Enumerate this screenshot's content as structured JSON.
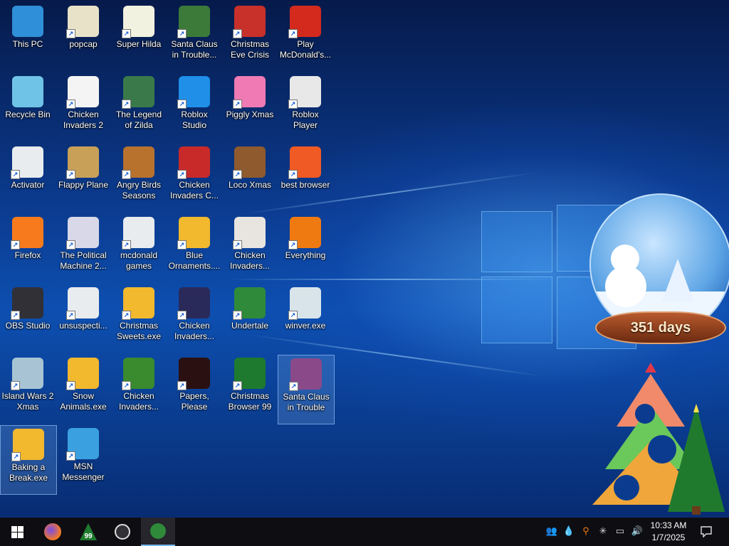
{
  "desktop": {
    "icons": [
      {
        "label": "This PC",
        "icon": "computer-icon",
        "color": "#2f8fd8"
      },
      {
        "label": "popcap",
        "icon": "folder-icon",
        "color": "#e8e2c8"
      },
      {
        "label": "Super Hilda",
        "icon": "game-icon",
        "color": "#f2f2e0"
      },
      {
        "label": "Santa Claus in Trouble... A...",
        "icon": "santa-icon",
        "color": "#3c7a3a"
      },
      {
        "label": "Christmas Eve Crisis",
        "icon": "santa-icon",
        "color": "#c8302a"
      },
      {
        "label": "Play McDonald's...",
        "icon": "mcdonalds-icon",
        "color": "#d42a1e"
      },
      {
        "label": "Recycle Bin",
        "icon": "recycle-bin-icon",
        "color": "#6fc3e6"
      },
      {
        "label": "Chicken Invaders 2",
        "icon": "chicken-icon",
        "color": "#f4f4f4"
      },
      {
        "label": "The Legend of Zilda",
        "icon": "game-icon",
        "color": "#3a7a4a"
      },
      {
        "label": "Roblox Studio",
        "icon": "roblox-studio-icon",
        "color": "#1f8fe8"
      },
      {
        "label": "Piggly Xmas",
        "icon": "pig-icon",
        "color": "#f07ab4"
      },
      {
        "label": "Roblox Player",
        "icon": "roblox-icon",
        "color": "#e8e8e8"
      },
      {
        "label": "Activator",
        "icon": "folder-icon",
        "color": "#e8ecee"
      },
      {
        "label": "Flappy Plane",
        "icon": "game-icon",
        "color": "#c8a058"
      },
      {
        "label": "Angry Birds Seasons",
        "icon": "angry-birds-icon",
        "color": "#b8722e"
      },
      {
        "label": "Chicken Invaders C...",
        "icon": "snowman-icon",
        "color": "#c82a2a"
      },
      {
        "label": "Loco Xmas",
        "icon": "bear-icon",
        "color": "#8e5a2e"
      },
      {
        "label": "best browser",
        "icon": "brave-icon",
        "color": "#f05a24"
      },
      {
        "label": "Firefox",
        "icon": "firefox-icon",
        "color": "#f77b1c"
      },
      {
        "label": "The Political Machine 2...",
        "icon": "political-icon",
        "color": "#d8d8e8"
      },
      {
        "label": "mcdonald games",
        "icon": "folder-icon",
        "color": "#e8ecee"
      },
      {
        "label": "Blue Ornaments....",
        "icon": "exe-icon",
        "color": "#f2b82e"
      },
      {
        "label": "Chicken Invaders...",
        "icon": "chicken-icon",
        "color": "#e8e4e0"
      },
      {
        "label": "Everything",
        "icon": "search-icon",
        "color": "#f07a12"
      },
      {
        "label": "OBS Studio",
        "icon": "obs-icon",
        "color": "#303036"
      },
      {
        "label": "unsuspecti...",
        "icon": "folder-icon",
        "color": "#e8ecee"
      },
      {
        "label": "Christmas Sweets.exe",
        "icon": "exe-icon",
        "color": "#f2b82e"
      },
      {
        "label": "Chicken Invaders...",
        "icon": "chicken-icon",
        "color": "#2a2a5a"
      },
      {
        "label": "Undertale",
        "icon": "undertale-icon",
        "color": "#2f8a3a"
      },
      {
        "label": "winver.exe",
        "icon": "window-icon",
        "color": "#d8e4ea"
      },
      {
        "label": "Island Wars 2 Xmas",
        "icon": "game-icon",
        "color": "#a8c4d4"
      },
      {
        "label": "Snow Animals.exe",
        "icon": "exe-icon",
        "color": "#f2b82e"
      },
      {
        "label": "Chicken Invaders...",
        "icon": "chicken-icon",
        "color": "#3a8a2e"
      },
      {
        "label": "Papers, Please",
        "icon": "papers-please-icon",
        "color": "#2a1010"
      },
      {
        "label": "Christmas Browser 99",
        "icon": "tree-icon",
        "color": "#1e7a2e"
      },
      {
        "label": "Santa Claus in Trouble",
        "icon": "santa-icon",
        "color": "#8a4a8a"
      },
      {
        "label": "Baking a Break.exe",
        "icon": "exe-icon",
        "color": "#f2b82e"
      },
      {
        "label": "MSN Messenger",
        "icon": "msn-icon",
        "color": "#3aa0e0"
      }
    ],
    "widget": {
      "days_text": "351 days"
    }
  },
  "taskbar": {
    "apps": [
      {
        "name": "start-icon"
      },
      {
        "name": "firefox-icon",
        "color": "#f77b1c"
      },
      {
        "name": "christmas-browser-icon",
        "color": "#1e7a2e",
        "text": "99"
      },
      {
        "name": "obs-icon",
        "color": "#303036"
      },
      {
        "name": "undertale-icon",
        "color": "#2f8a3a"
      }
    ],
    "tray_icons": [
      "people-icon",
      "droplet-icon",
      "search-icon",
      "snowflake-icon",
      "network-icon",
      "volume-icon"
    ],
    "time": "10:33 AM",
    "date": "1/7/2025",
    "notification_icon": "notification-icon"
  }
}
